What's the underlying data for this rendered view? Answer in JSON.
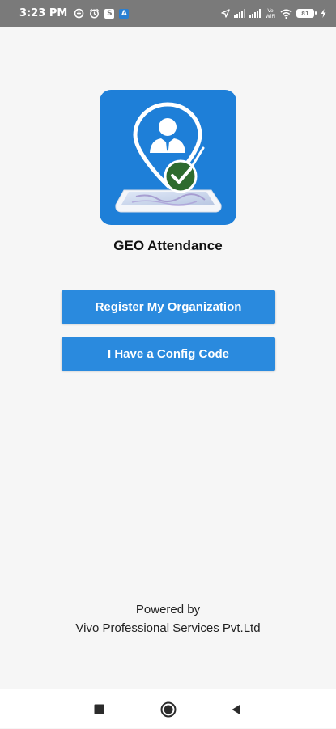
{
  "status_bar": {
    "time": "3:23 PM",
    "left_icons": [
      "data-saver-icon",
      "alarm-icon",
      "notification-square-icon",
      "app-notification-icon"
    ],
    "right_icons": [
      "location-arrow-icon",
      "signal-icon",
      "signal-icon",
      "vowifi-icon",
      "wifi-icon",
      "battery-icon",
      "charging-icon"
    ],
    "vowifi_label": "Vo WiFi",
    "battery_level": "81",
    "notification_square_glyph": "S",
    "app_notification_glyph": "A"
  },
  "app": {
    "name": "GEO Attendance",
    "logo_icon": "geo-attendance-logo-icon"
  },
  "buttons": {
    "register": "Register My Organization",
    "config": "I Have a Config Code"
  },
  "footer": {
    "powered_by": "Powered by",
    "company": "Vivo Professional Services Pvt.Ltd"
  },
  "nav_bar": {
    "icons": [
      "recents-square-icon",
      "home-circle-icon",
      "back-triangle-icon"
    ]
  },
  "colors": {
    "status_bar_bg": "#7a7a7a",
    "page_bg": "#f6f6f6",
    "button_bg": "#2a8ade",
    "logo_bg": "#1e7fd8",
    "check_green": "#2e6b2e",
    "text_dark": "#111111"
  }
}
